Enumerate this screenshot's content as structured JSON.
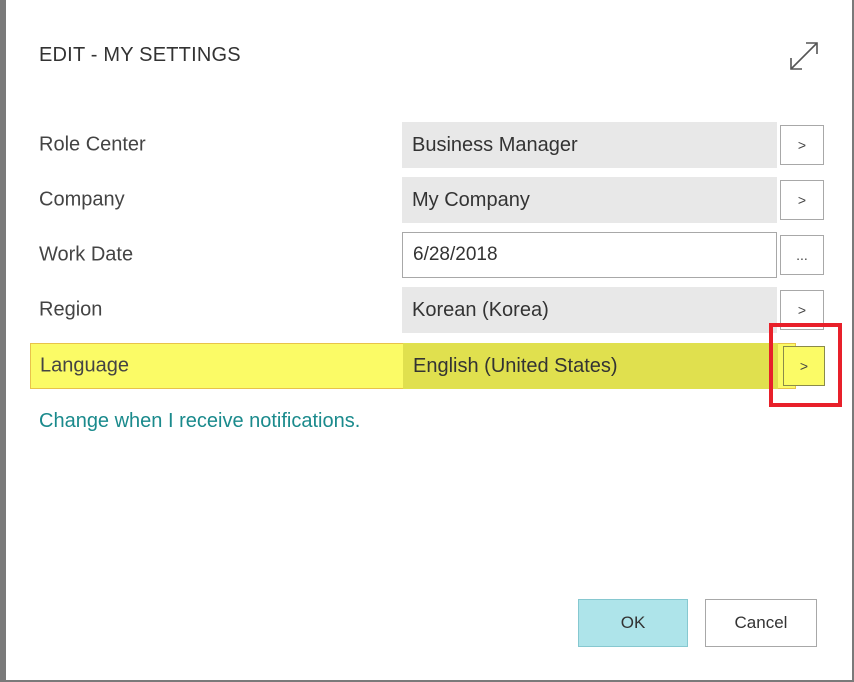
{
  "dialog": {
    "title": "EDIT - MY SETTINGS",
    "expand_icon": "expand-diagonal-icon"
  },
  "fields": [
    {
      "label": "Role Center",
      "value": "Business Manager",
      "button": ">"
    },
    {
      "label": "Company",
      "value": "My Company",
      "button": ">"
    },
    {
      "label": "Work Date",
      "value": "6/28/2018",
      "button": "..."
    },
    {
      "label": "Region",
      "value": "Korean (Korea)",
      "button": ">"
    },
    {
      "label": "Language",
      "value": "English (United States)",
      "button": ">"
    }
  ],
  "notification_link": "Change when I receive notifications.",
  "buttons": {
    "ok": "OK",
    "cancel": "Cancel"
  },
  "colors": {
    "highlight": "#fbfb66",
    "annotation_red": "#e8202a",
    "link": "#1a8a8c",
    "ok_button": "#aee4ea"
  }
}
